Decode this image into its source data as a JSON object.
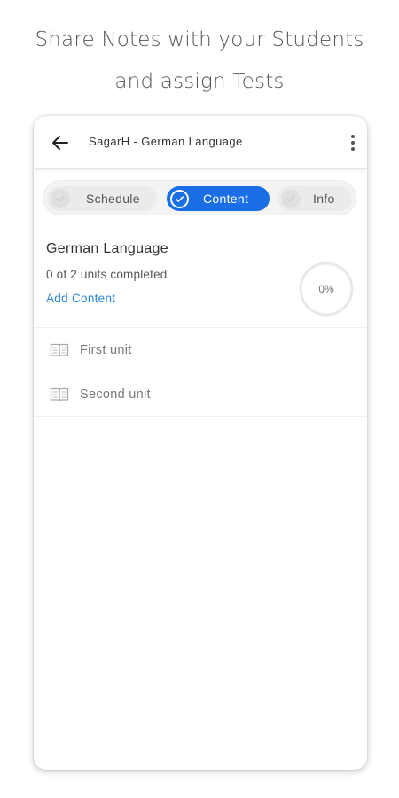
{
  "promo": {
    "line1": "Share Notes with your Students",
    "line2": "and assign Tests"
  },
  "appbar": {
    "title": "SagarH - German Language",
    "back_icon": "arrow-left-icon",
    "menu_icon": "more-vertical-icon"
  },
  "tabs": [
    {
      "label": "Schedule",
      "active": false
    },
    {
      "label": "Content",
      "active": true
    },
    {
      "label": "Info",
      "active": false
    }
  ],
  "course": {
    "title": "German Language",
    "progress_text": "0 of 2 units completed",
    "add_content": "Add Content",
    "percent_label": "0%",
    "percent": 0
  },
  "units": [
    {
      "label": "First unit",
      "icon": "book-icon"
    },
    {
      "label": "Second unit",
      "icon": "book-icon"
    }
  ],
  "colors": {
    "accent": "#1a6ee6",
    "link": "#2a86d6"
  }
}
